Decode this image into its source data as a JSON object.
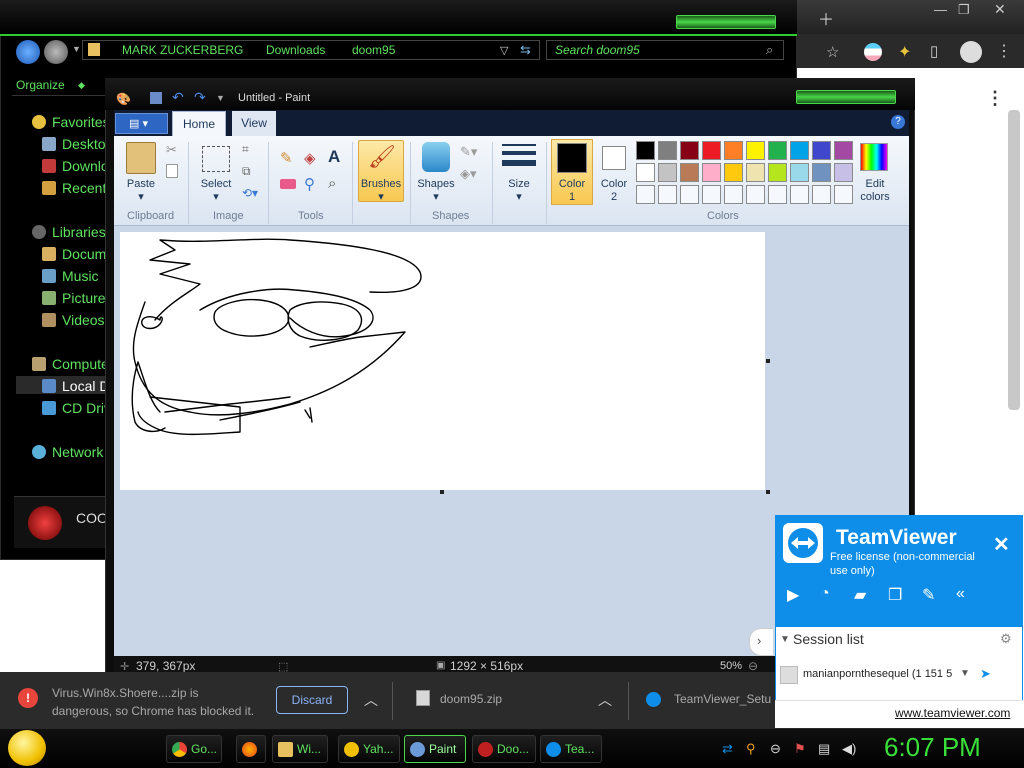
{
  "explorer": {
    "breadcrumb": [
      "MARK ZUCKERBERG",
      "Downloads",
      "doom95"
    ],
    "search_placeholder": "Search doom95",
    "organize": "Organize",
    "nav": {
      "favorites": "Favorites",
      "desktop": "Deskto",
      "downloads": "Downlo",
      "recent": "Recent",
      "libraries": "Libraries",
      "documents": "Docum",
      "music": "Music",
      "pictures": "Picture",
      "videos": "Videos",
      "computer": "Compute",
      "local_disk": "Local D",
      "cd_drive": "CD Driv",
      "network": "Network"
    },
    "thumb_label": "COO"
  },
  "paint": {
    "title": "Untitled - Paint",
    "tabs": {
      "home": "Home",
      "view": "View"
    },
    "ribbon": {
      "paste": "Paste",
      "clipboard": "Clipboard",
      "select": "Select",
      "image": "Image",
      "tools": "Tools",
      "brushes": "Brushes",
      "shapes": "Shapes",
      "shapes_group": "Shapes",
      "size": "Size",
      "color1": "Color",
      "color1_num": "1",
      "color2": "Color",
      "color2_num": "2",
      "colors_group": "Colors",
      "edit_colors_1": "Edit",
      "edit_colors_2": "colors"
    },
    "palette": [
      "#000000",
      "#7f7f7f",
      "#880015",
      "#ed1c24",
      "#ff7f27",
      "#fff200",
      "#22b14c",
      "#00a2e8",
      "#3f48cc",
      "#a349a4",
      "#ffffff",
      "#c3c3c3",
      "#b97a57",
      "#ffaec9",
      "#ffc90e",
      "#efe4b0",
      "#b5e61d",
      "#99d9ea",
      "#7092be",
      "#c8bfe7"
    ],
    "status": {
      "cursor": "379, 367px",
      "size": "1292 × 516px",
      "zoom": "50%"
    }
  },
  "teamviewer": {
    "title": "TeamViewer",
    "subtitle": "Free license (non-commercial use only)",
    "session_list": "Session list",
    "entry": "manianpornthesequel (1 151 5",
    "link": "www.teamviewer.com"
  },
  "download_bar": {
    "warning_line1": "Virus.Win8x.Shoere....zip is",
    "warning_line2": "dangerous, so Chrome has blocked it.",
    "discard": "Discard",
    "file2": "doom95.zip",
    "file3": "TeamViewer_Setu"
  },
  "taskbar": {
    "tasks": [
      "Go...",
      "",
      "Wi...",
      "Yah...",
      "Paint",
      "Doo...",
      "Tea..."
    ],
    "clock": "6:07 PM"
  },
  "colors": {
    "green_accent": "#5fe25f",
    "teamviewer_blue": "#0e8ee9",
    "paint_ribbon": "#f5f8fc"
  }
}
